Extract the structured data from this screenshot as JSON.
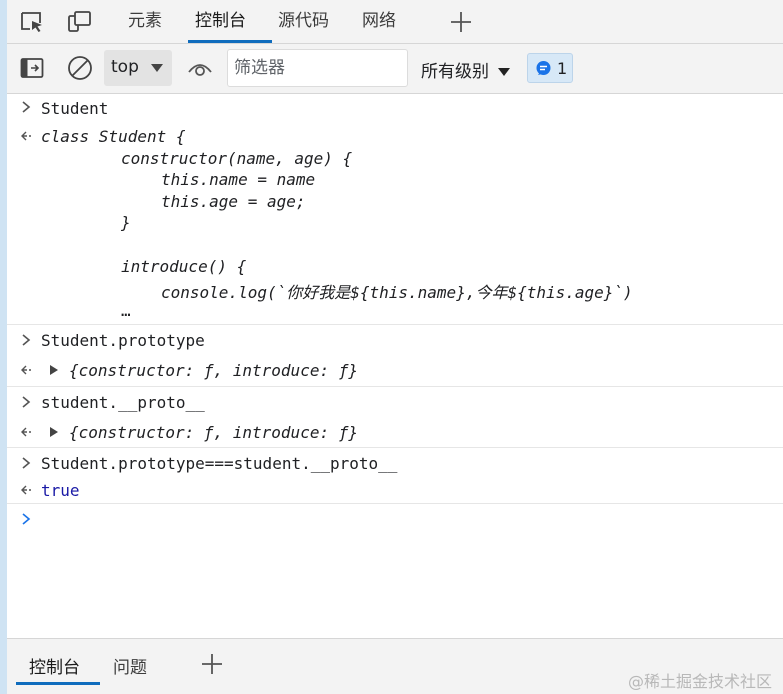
{
  "tabs": {
    "items": [
      "元素",
      "控制台",
      "源代码",
      "网络"
    ],
    "active": "控制台"
  },
  "toolbar": {
    "context_label": "top",
    "filter_placeholder": "筛选器",
    "levels_label": "所有级别",
    "message_count": "1"
  },
  "console": {
    "entries": [
      {
        "input": "Student",
        "output_lines": [
          "class Student {",
          "constructor(name, age) {",
          "this.name = name",
          "this.age = age;",
          "}",
          "introduce() {",
          "console.log(`你好我是${this.name},今年${this.age}`)",
          "…"
        ]
      },
      {
        "input": "Student.prototype",
        "output": "{constructor: ƒ, introduce: ƒ}"
      },
      {
        "input": "student.__proto__",
        "output": "{constructor: ƒ, introduce: ƒ}"
      },
      {
        "input": "Student.prototype===student.__proto__",
        "output": "true"
      }
    ]
  },
  "bottom_tabs": {
    "items": [
      "控制台",
      "问题"
    ],
    "active": "控制台"
  },
  "watermark": "@稀土掘金技术社区",
  "colors": {
    "accent": "#0f6cbd",
    "keyword": "#881280",
    "boolean": "#1a1aa6",
    "prompt": "#1a73e8"
  },
  "icons": [
    "inspect-element-icon",
    "device-emulation-icon",
    "add-tab-icon",
    "toggle-sidebar-icon",
    "clear-console-icon",
    "dropdown-caret-icon",
    "live-expression-eye-icon",
    "chat-message-icon",
    "chevron-right-icon",
    "return-arrow-icon",
    "expand-triangle-icon"
  ]
}
